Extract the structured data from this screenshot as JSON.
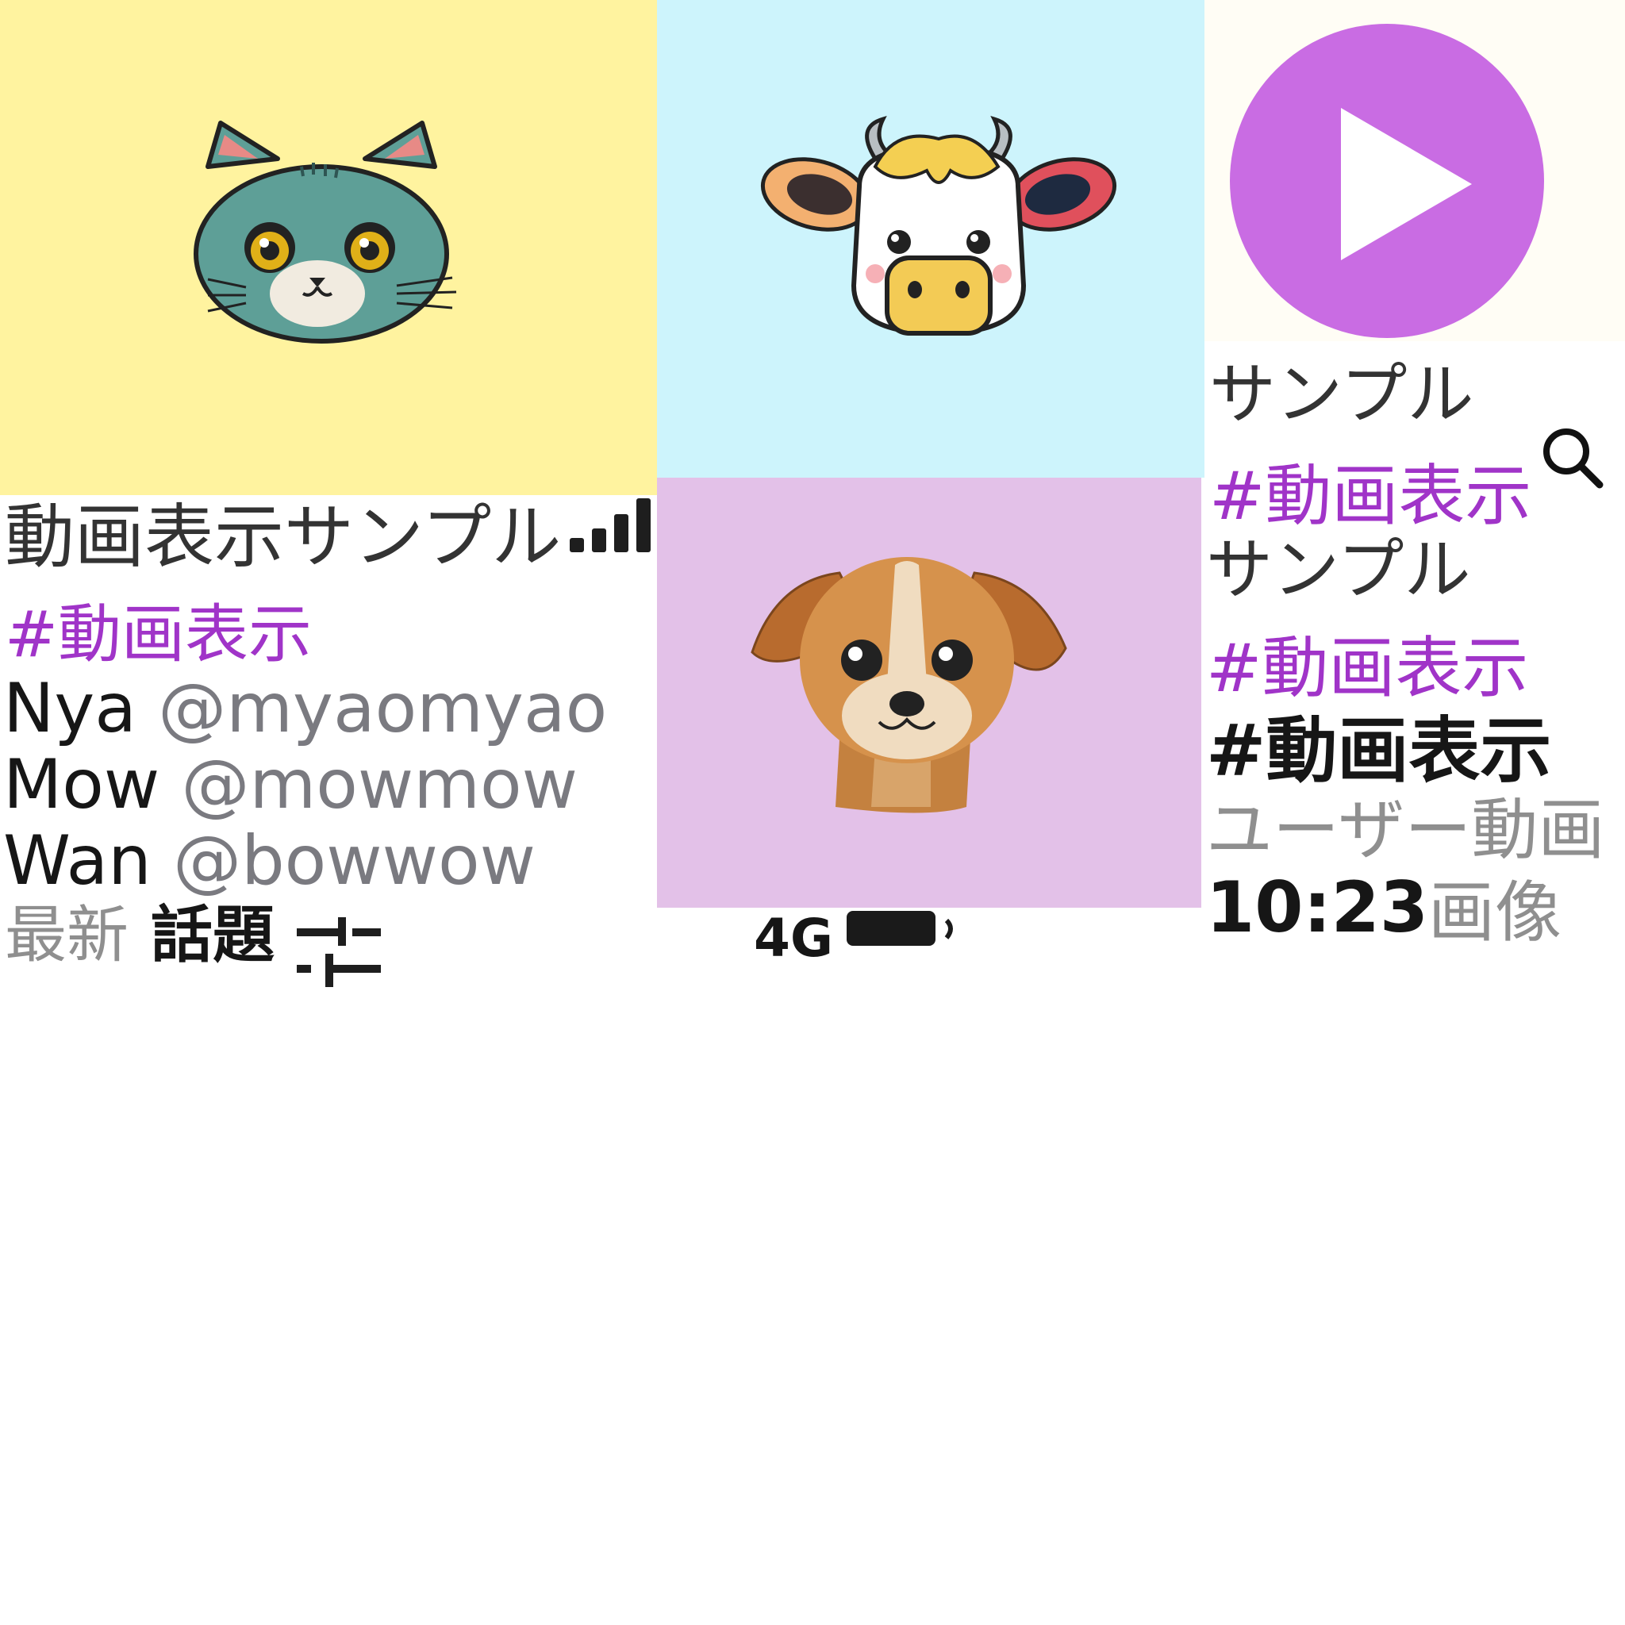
{
  "left": {
    "title": "動画表示サンプル",
    "hashtag": "#動画表示",
    "accounts": [
      {
        "name": "Nya",
        "handle": "@myaomyao"
      },
      {
        "name": "Mow",
        "handle": "@mowmow"
      },
      {
        "name": "Wan",
        "handle": "@bowwow"
      }
    ],
    "tabs": {
      "latest": "最新",
      "topics": "話題"
    }
  },
  "middle": {
    "status": {
      "network": "4G"
    }
  },
  "right": {
    "sample_1": "サンプル",
    "hashtag_1": "#動画表示",
    "sample_2": "サンプル",
    "hashtag_2": "#動画表示",
    "hashtag_bold": "#動画表示",
    "user_video": "ユーザー動画",
    "time": "10:23",
    "image_label": "画像"
  },
  "icons": [
    "signal-icon",
    "filter-icon",
    "battery-icon",
    "play-icon",
    "search-icon",
    "cat-image",
    "cow-image",
    "dog-image"
  ],
  "colors": {
    "cat_bg": "#fff39f",
    "cow_bg": "#cdf4fc",
    "dog_bg": "#e3c1e8",
    "play_circle": "#c96ce3",
    "hashtag": "#a034c8"
  }
}
